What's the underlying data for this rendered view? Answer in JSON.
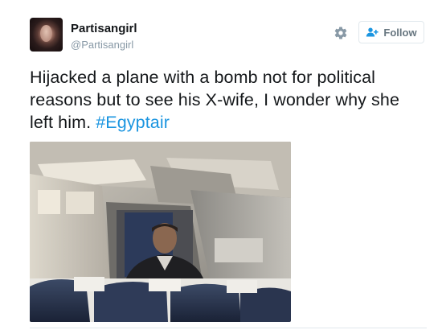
{
  "user": {
    "display_name": "Partisangirl",
    "handle": "@Partisangirl"
  },
  "actions": {
    "follow_label": "Follow",
    "settings_icon": "gear-icon",
    "follow_icon": "add-person-icon"
  },
  "tweet": {
    "text": "Hijacked a plane with a bomb not for political reasons but to see his X-wife, I wonder why she left him. ",
    "hashtag": "#Egyptair"
  },
  "colors": {
    "link": "#1b95e0",
    "secondary_text": "#8899a6",
    "button_text": "#66757f"
  }
}
